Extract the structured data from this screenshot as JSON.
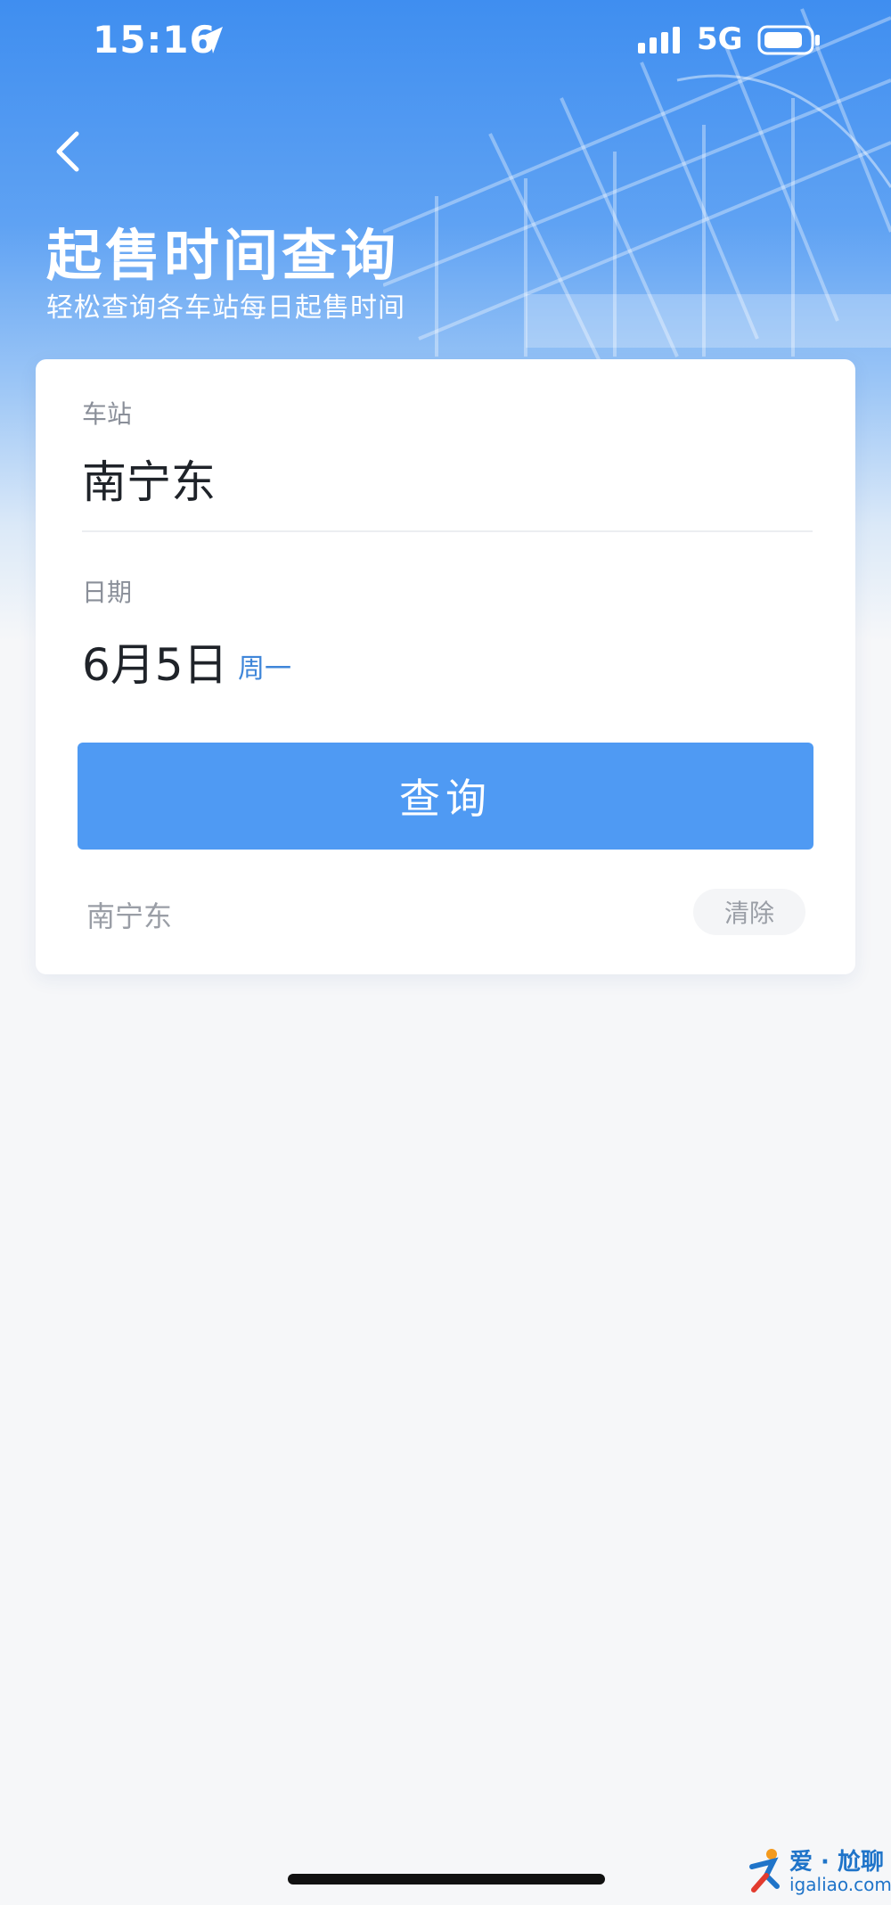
{
  "status_bar": {
    "time": "15:16",
    "network": "5G",
    "location_icon": "location-arrow-icon",
    "signal_icon": "signal-bars-icon",
    "battery_icon": "battery-icon"
  },
  "header": {
    "title": "起售时间查询",
    "subtitle": "轻松查询各车站每日起售时间",
    "back_icon": "chevron-left-icon"
  },
  "form": {
    "station_label": "车站",
    "station_value": "南宁东",
    "date_label": "日期",
    "date_value": "6月5日",
    "weekday": "周一",
    "query_button": "查询"
  },
  "history": {
    "items": [
      "南宁东"
    ],
    "clear_button": "清除"
  },
  "watermark": {
    "text": "爱 · 尬聊",
    "domain": "igaliao.com"
  },
  "colors": {
    "accent": "#4f9af3",
    "weekday": "#3f86d9",
    "header_top": "#3f8ef0",
    "background": "#f6f7f9"
  }
}
